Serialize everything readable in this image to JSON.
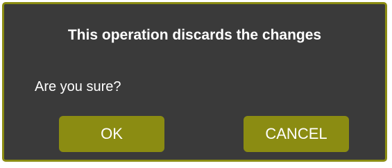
{
  "dialog": {
    "title": "This operation discards the changes",
    "message": "Are you sure?",
    "ok_label": "OK",
    "cancel_label": "CANCEL"
  },
  "colors": {
    "dialog_background": "#3a3a3a",
    "accent": "#8b8c12",
    "text": "#ffffff"
  }
}
